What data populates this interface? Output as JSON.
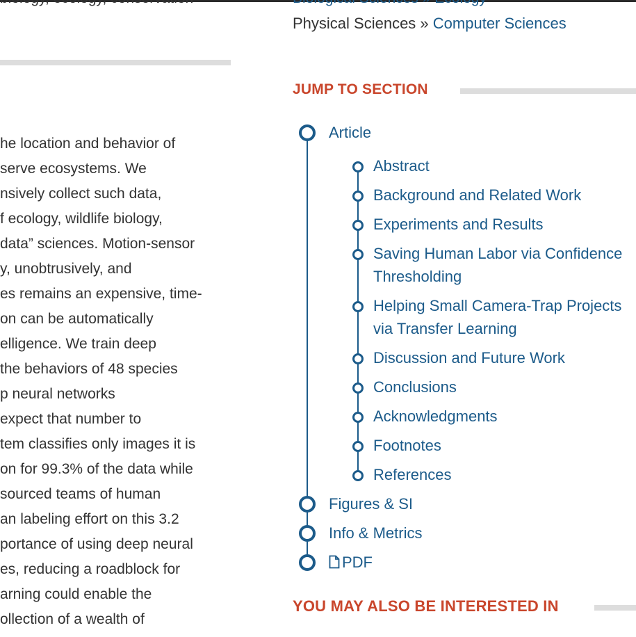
{
  "left": {
    "cut_top_line": "biology, ecology, conservation",
    "abstract_lines": [
      "he location and behavior of",
      "serve ecosystems. We",
      "nsively collect such data,",
      "f ecology, wildlife biology,",
      "data” sciences. Motion-sensor",
      "y, unobtrusively, and",
      "es remains an expensive, time-",
      "on can be automatically",
      "elligence. We train deep",
      " the behaviors of 48 species",
      "p neural networks",
      "expect that number to",
      "tem classifies only images it is",
      "on for 99.3% of the data while",
      "sourced teams of human",
      "an labeling effort on this 3.2",
      "portance of using deep neural",
      "es, reducing a roadblock for",
      "arning could enable the",
      "ollection of a wealth of"
    ]
  },
  "subjects": {
    "cut_line": "Biological Sciences » Ecology",
    "category": "Physical Sciences",
    "separator": " » ",
    "subcategory": "Computer Sciences"
  },
  "jump_section": {
    "heading": "JUMP TO SECTION",
    "items": [
      {
        "label": "Article",
        "level": 1
      },
      {
        "label": "Abstract",
        "level": 2
      },
      {
        "label": "Background and Related Work",
        "level": 2
      },
      {
        "label": "Experiments and Results",
        "level": 2
      },
      {
        "label": "Saving Human Labor via Confidence Thresholding",
        "level": 2
      },
      {
        "label": "Helping Small Camera-Trap Projects via Transfer Learning",
        "level": 2
      },
      {
        "label": "Discussion and Future Work",
        "level": 2
      },
      {
        "label": "Conclusions",
        "level": 2
      },
      {
        "label": "Acknowledgments",
        "level": 2
      },
      {
        "label": "Footnotes",
        "level": 2
      },
      {
        "label": "References",
        "level": 2
      },
      {
        "label": "Figures & SI",
        "level": 1
      },
      {
        "label": "Info & Metrics",
        "level": 1
      },
      {
        "label": "PDF",
        "level": 1,
        "icon": "document-icon"
      }
    ]
  },
  "also_interested": {
    "heading": "YOU MAY ALSO BE INTERESTED IN"
  },
  "colors": {
    "link": "#1c5b8a",
    "heading": "#c9462c",
    "rule": "#dddddd"
  }
}
